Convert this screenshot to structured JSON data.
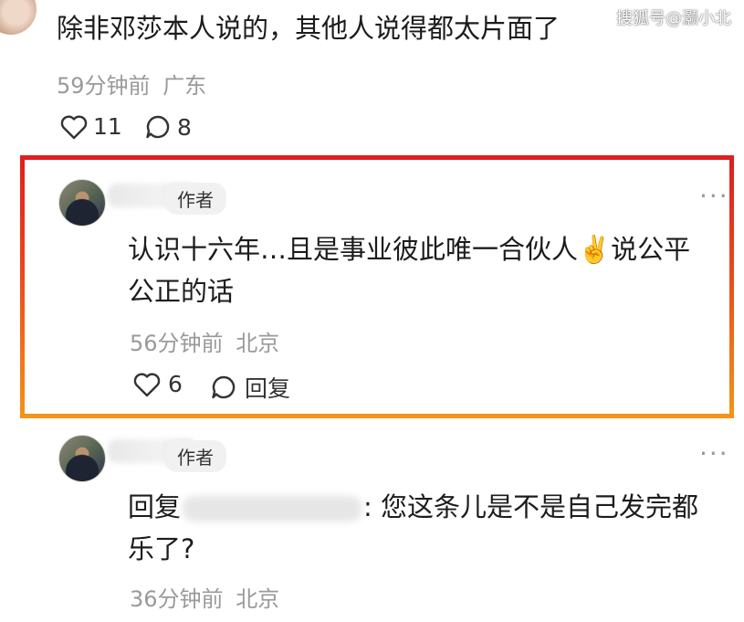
{
  "watermark": "搜狐号@灏小北",
  "comments": [
    {
      "text": "除非邓莎本人说的，其他人说得都太片面了",
      "time": "59分钟前",
      "location": "广东",
      "likes": "11",
      "replies": "8"
    },
    {
      "badge": "作者",
      "text_line1": "认识十六年…且是事业彼此唯一合伙人",
      "emoji": "✌️",
      "text_line1_tail": "说公平",
      "text_line2": "公正的话",
      "time": "56分钟前",
      "location": "北京",
      "likes": "6",
      "reply_label": "回复",
      "more": "···",
      "highlight_colors": [
        "#e01e1e",
        "#f39318"
      ]
    },
    {
      "badge": "作者",
      "reply_prefix": "回复",
      "text_after_mention": ": 您这条儿是不是自己发完都",
      "text_line2": "乐了?",
      "time": "36分钟前",
      "location": "北京",
      "more": "···"
    }
  ]
}
